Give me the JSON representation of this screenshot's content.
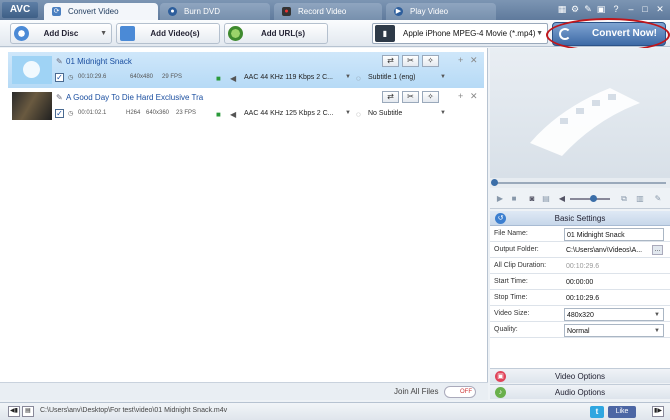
{
  "app": {
    "logo": "AVC"
  },
  "tabs": [
    {
      "label": "Convert Video",
      "icon": "refresh-icon"
    },
    {
      "label": "Burn DVD",
      "icon": "disc-icon"
    },
    {
      "label": "Record Video",
      "icon": "record-icon"
    },
    {
      "label": "Play Video",
      "icon": "play-icon"
    }
  ],
  "toolbar": {
    "add_disc": "Add Disc",
    "add_videos": "Add Video(s)",
    "add_urls": "Add URL(s)",
    "profile": "Apple iPhone MPEG-4 Movie (*.mp4)",
    "convert_now": "Convert Now!"
  },
  "files": [
    {
      "name": "01 Midnight Snack",
      "duration": "00:10:29.6",
      "resolution": "640x480",
      "fps": "29 FPS",
      "audio": "AAC 44 KHz 119 Kbps 2 C...",
      "subtitle": "Subtitle 1 (eng)"
    },
    {
      "name": "A Good Day To Die Hard Exclusive Tra",
      "duration": "00:01:02.1",
      "codec": "H264",
      "resolution": "640x360",
      "fps": "23 FPS",
      "audio": "AAC 44 KHz 125 Kbps 2 C...",
      "subtitle": "No Subtitle"
    }
  ],
  "join": {
    "label": "Join All Files",
    "toggle": "OFF"
  },
  "settings": {
    "header": "Basic Settings",
    "rows": [
      {
        "key": "File Name:",
        "value": "01 Midnight Snack"
      },
      {
        "key": "Output Folder:",
        "value": "C:\\Users\\anv\\Videos\\A..."
      },
      {
        "key": "All Clip Duration:",
        "value": "00:10:29.6"
      },
      {
        "key": "Start Time:",
        "value": "00:00:00"
      },
      {
        "key": "Stop Time:",
        "value": "00:10:29.6"
      },
      {
        "key": "Video Size:",
        "value": "480x320"
      },
      {
        "key": "Quality:",
        "value": "Normal"
      }
    ],
    "video_options": "Video Options",
    "audio_options": "Audio Options"
  },
  "status": {
    "path": "C:\\Users\\anv\\Desktop\\For test\\video\\01 Midnight Snack.m4v",
    "twitter": "t",
    "like": "Like"
  },
  "colors": {
    "accent": "#3d6aa6",
    "highlight_ring": "#c0161b",
    "selected_row": "#b6daf6"
  }
}
